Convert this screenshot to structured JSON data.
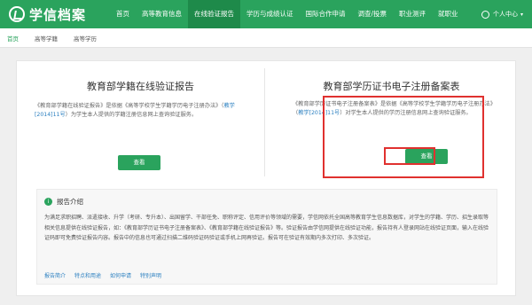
{
  "header": {
    "logo_text": "学信档案",
    "nav": [
      {
        "label": "首页",
        "active": false
      },
      {
        "label": "高等教育信息",
        "active": false
      },
      {
        "label": "在线验证报告",
        "active": true
      },
      {
        "label": "学历与成绩认证",
        "active": false
      },
      {
        "label": "国际合作申请",
        "active": false
      },
      {
        "label": "调查/投票",
        "active": false
      },
      {
        "label": "职业测评",
        "active": false
      },
      {
        "label": "就职业",
        "active": false
      }
    ],
    "user_label": "个人中心",
    "user_caret": "▾"
  },
  "subnav": {
    "items": [
      "首页",
      "高等学籍",
      "高等学历"
    ]
  },
  "left_card": {
    "title": "教育部学籍在线验证报告",
    "desc_pre": "《教育部学籍在线验证报告》是依据《高等学校学生学籍学历电子注册办法》（",
    "desc_link": "教学[2014]11号",
    "desc_post": "）为学生本人提供的学籍注册信息网上查询验证服务。",
    "button": "查看"
  },
  "right_card": {
    "title": "教育部学历证书电子注册备案表",
    "desc_pre": "《教育部学历证书电子注册备案表》是依据《高等学校学生学籍学历电子注册办法》（",
    "desc_link": "教学[2014]11号",
    "desc_post": "）对学生本人提供的学历注册信息网上查询验证服务。",
    "button": "查看"
  },
  "intro": {
    "icon": "i",
    "title": "报告介绍",
    "text": "为满足求职招聘、派遣接收、升学（考研、专升本）、出国留学、干部任免、职称评定、信用评价等领域的需要，学信网依托全国高等教育学生信息数据库，对学生的学籍、学历、招生录取等相关信息提供在线验证报告，如：《教育部学历证书电子注册备案表》、《教育部学籍在线验证报告》等。验证报告由学信网提供在线验证功能，报告持有人登录网站在线验证页面，输入在线验证码即可免费验证报告内容。报告中的信息也可通过扫描二维码验证码验证或手机上网再验证。报告可在验证有效期内多次打印、多次验证。",
    "links": [
      "报告简介",
      "特点和用途",
      "如何申请",
      "特别声明"
    ]
  },
  "colors": {
    "brand": "#2aa35d",
    "highlight": "#e0312f",
    "link": "#2a7fc0"
  }
}
